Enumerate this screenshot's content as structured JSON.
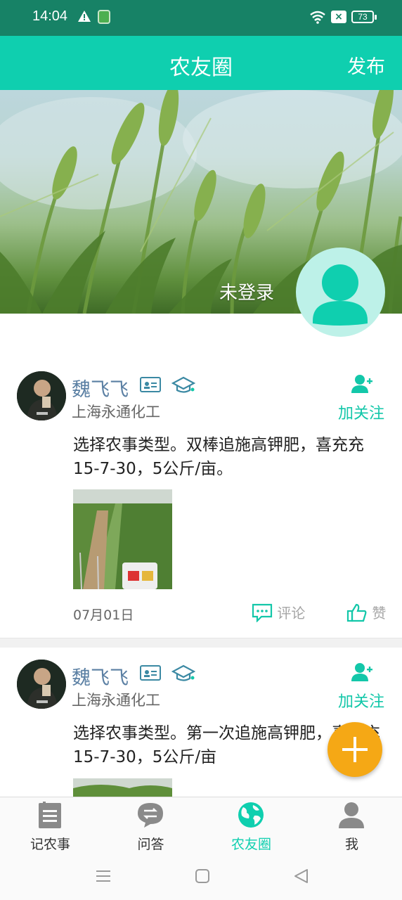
{
  "status_bar": {
    "time": "14:04",
    "battery": "73"
  },
  "header": {
    "title": "农友圈",
    "publish_label": "发布"
  },
  "hero": {
    "login_label": "未登录"
  },
  "posts": [
    {
      "name": "魏飞飞",
      "company": "上海永通化工",
      "follow_label": "加关注",
      "content": "选择农事类型。双棒追施高钾肥，喜充充15-7-30，5公斤/亩。",
      "date": "07月01日",
      "comment_label": "评论",
      "like_label": "赞"
    },
    {
      "name": "魏飞飞",
      "company": "上海永通化工",
      "follow_label": "加关注",
      "content": "选择农事类型。第一次追施高钾肥，喜充充15-7-30，5公斤/亩"
    }
  ],
  "bottom_nav": [
    {
      "label": "记农事",
      "icon": "notebook-icon"
    },
    {
      "label": "问答",
      "icon": "chat-exchange-icon"
    },
    {
      "label": "农友圈",
      "icon": "globe-icon",
      "active": true
    },
    {
      "label": "我",
      "icon": "person-icon"
    }
  ],
  "colors": {
    "accent": "#0fcfaf",
    "status_bar": "#178266",
    "fab": "#f5a815",
    "name": "#5a7fa3"
  }
}
